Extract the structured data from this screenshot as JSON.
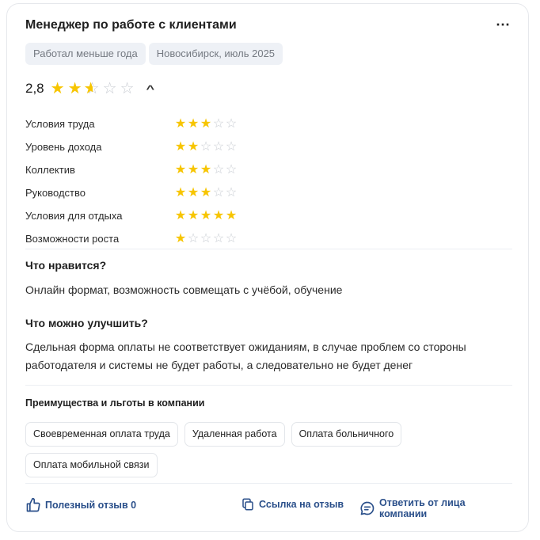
{
  "review": {
    "title": "Менеджер по работе с клиентами",
    "more_icon": "⋯",
    "tags": [
      "Работал меньше года",
      "Новосибирск, июль 2025"
    ],
    "overall": {
      "score_text": "2,8",
      "rating": 2.5,
      "max": 5
    },
    "categories": [
      {
        "label": "Условия труда",
        "rating": 3
      },
      {
        "label": "Уровень дохода",
        "rating": 2
      },
      {
        "label": "Коллектив",
        "rating": 3
      },
      {
        "label": "Руководство",
        "rating": 3
      },
      {
        "label": "Условия для отдыха",
        "rating": 5
      },
      {
        "label": "Возможности роста",
        "rating": 1
      }
    ],
    "likes": {
      "heading": "Что нравится?",
      "text": "Онлайн формат, возможность совмещать с учёбой, обучение"
    },
    "improve": {
      "heading": "Что можно улучшить?",
      "text": "Сдельная форма оплаты не соответствует ожиданиям, в случае проблем со стороны работодателя и системы не будет работы, а следовательно не будет денег"
    },
    "benefits": {
      "title": "Преимущества и льготы в компании",
      "items": [
        "Своевременная оплата труда",
        "Удаленная работа",
        "Оплата больничного",
        "Оплата мобильной связи"
      ]
    },
    "actions": {
      "helpful": "Полезный отзыв 0",
      "link": "Ссылка на отзыв",
      "reply": "Ответить от лица компании"
    }
  },
  "colors": {
    "star": "#f7c500",
    "star_empty": "#c9cdd3",
    "action": "#2a4f8a",
    "tag_bg": "#eef1f6"
  },
  "icons": {
    "helpful": "thumbs-up-icon",
    "link": "copy-link-icon",
    "reply": "chat-bubble-icon",
    "expand": "chevron-up-icon"
  }
}
